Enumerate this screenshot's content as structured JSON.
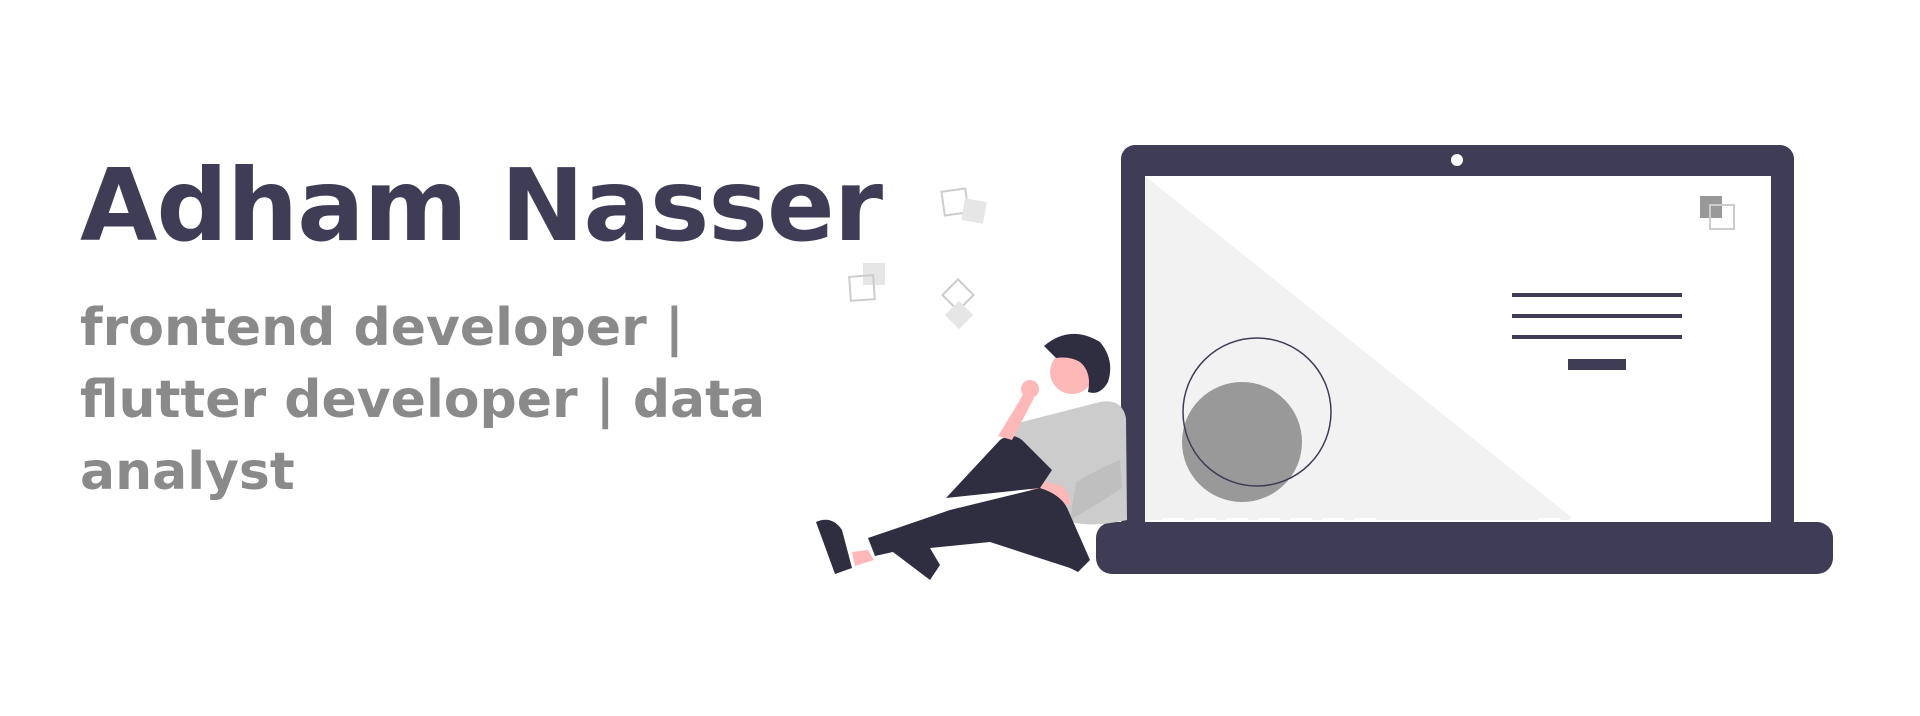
{
  "hero": {
    "name": "Adham Nasser",
    "tagline": "frontend developer | flutter developer | data analyst"
  },
  "illustration": {
    "subject": "person-sitting-by-laptop",
    "colors": {
      "laptop_frame": "#3f3d56",
      "screen": "#ffffff",
      "screen_shade": "#f2f2f2",
      "accent_gray": "#999999",
      "skin": "#ffb8b8",
      "shirt": "#cccccc",
      "pants": "#2f2e41"
    }
  }
}
